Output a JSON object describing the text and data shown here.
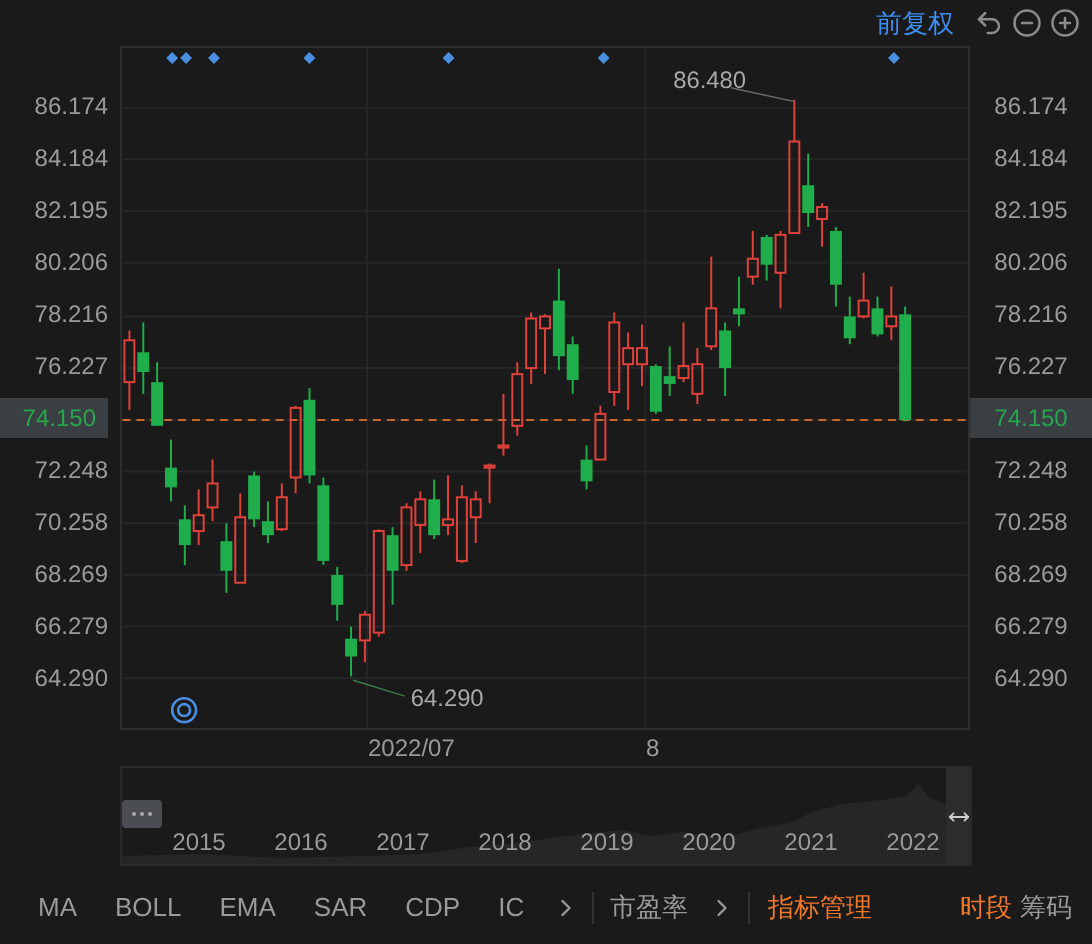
{
  "header": {
    "adjust_mode": "前复权"
  },
  "chart": {
    "high_label": "86.480",
    "low_label": "64.290",
    "x_labels": [
      "2022/07",
      "8"
    ],
    "chart_data": {
      "type": "candlestick",
      "ylim": [
        62.3,
        88.47
      ],
      "grid": true,
      "ref_lines": [
        {
          "axis": "y",
          "value": 74.15,
          "label": "74.150"
        }
      ],
      "yticks": [
        {
          "value": 86.174,
          "label": "86.174"
        },
        {
          "value": 84.184,
          "label": "84.184"
        },
        {
          "value": 82.195,
          "label": "82.195"
        },
        {
          "value": 80.206,
          "label": "80.206"
        },
        {
          "value": 78.216,
          "label": "78.216"
        },
        {
          "value": 76.227,
          "label": "76.227"
        },
        {
          "value": 72.248,
          "label": "72.248"
        },
        {
          "value": 70.258,
          "label": "70.258"
        },
        {
          "value": 68.269,
          "label": "68.269"
        },
        {
          "value": 66.279,
          "label": "66.279"
        },
        {
          "value": 64.29,
          "label": "64.290"
        }
      ],
      "categories": [
        null,
        null,
        null,
        null,
        null,
        null,
        null,
        null,
        null,
        null,
        null,
        null,
        null,
        null,
        null,
        null,
        null,
        null,
        null,
        null,
        null,
        null,
        null,
        null,
        null,
        null,
        null,
        null,
        null,
        null,
        null,
        null,
        null,
        null,
        null,
        null,
        null,
        null,
        null,
        null,
        null,
        null,
        null,
        null,
        null,
        null,
        null,
        null,
        null,
        null,
        null,
        null,
        null,
        null,
        null,
        null,
        null,
        null,
        null,
        null,
        null
      ],
      "ohlc": [
        [
          75.61,
          77.6,
          74.54,
          77.22
        ],
        [
          76.76,
          77.91,
          75.16,
          76.0
        ],
        [
          75.61,
          76.38,
          73.93,
          73.93
        ],
        [
          72.32,
          73.4,
          71.02,
          71.56
        ],
        [
          70.33,
          70.87,
          68.57,
          69.34
        ],
        [
          69.88,
          71.48,
          69.34,
          70.49
        ],
        [
          70.79,
          72.63,
          70.26,
          71.71
        ],
        [
          69.49,
          70.18,
          67.5,
          68.35
        ],
        [
          67.89,
          71.33,
          67.89,
          70.41
        ],
        [
          72.02,
          72.17,
          70.03,
          70.33
        ],
        [
          70.26,
          71.02,
          69.42,
          69.72
        ],
        [
          69.95,
          71.71,
          69.88,
          71.18
        ],
        [
          71.94,
          74.7,
          71.33,
          74.62
        ],
        [
          74.93,
          75.38,
          71.71,
          72.02
        ],
        [
          71.64,
          71.94,
          68.57,
          68.73
        ],
        [
          68.19,
          68.5,
          66.43,
          67.04
        ],
        [
          65.74,
          66.2,
          64.29,
          65.05
        ],
        [
          65.67,
          66.81,
          64.83,
          66.66
        ],
        [
          65.97,
          69.95,
          65.82,
          69.88
        ],
        [
          69.72,
          70.03,
          67.04,
          68.35
        ],
        [
          68.57,
          70.95,
          68.35,
          70.79
        ],
        [
          70.11,
          71.41,
          69.03,
          71.1
        ],
        [
          71.1,
          71.86,
          69.57,
          69.72
        ],
        [
          70.11,
          72.02,
          69.72,
          70.33
        ],
        [
          68.73,
          71.64,
          68.65,
          71.18
        ],
        [
          70.41,
          71.41,
          69.42,
          71.1
        ],
        [
          72.32,
          72.48,
          70.95,
          72.4
        ],
        [
          73.09,
          75.16,
          72.78,
          73.17
        ],
        [
          73.93,
          76.38,
          73.55,
          75.92
        ],
        [
          76.15,
          78.29,
          75.54,
          78.06
        ],
        [
          77.68,
          78.22,
          75.92,
          78.14
        ],
        [
          78.75,
          79.98,
          76.07,
          76.61
        ],
        [
          77.07,
          77.37,
          75.16,
          75.69
        ],
        [
          72.63,
          73.17,
          71.48,
          71.79
        ],
        [
          72.63,
          74.7,
          72.63,
          74.39
        ],
        [
          75.23,
          78.29,
          74.7,
          77.91
        ],
        [
          76.3,
          77.53,
          74.54,
          76.92
        ],
        [
          76.3,
          77.83,
          75.46,
          76.92
        ],
        [
          76.23,
          76.3,
          74.39,
          74.47
        ],
        [
          75.84,
          76.99,
          75.08,
          75.54
        ],
        [
          75.77,
          77.91,
          75.61,
          76.23
        ],
        [
          75.16,
          76.92,
          74.77,
          76.3
        ],
        [
          76.99,
          80.44,
          76.84,
          78.45
        ],
        [
          77.6,
          77.91,
          75.08,
          76.15
        ],
        [
          78.45,
          79.67,
          77.76,
          78.22
        ],
        [
          79.67,
          81.43,
          79.36,
          80.36
        ],
        [
          81.2,
          81.28,
          79.52,
          80.13
        ],
        [
          79.82,
          81.43,
          78.45,
          81.28
        ],
        [
          81.35,
          86.48,
          81.35,
          84.87
        ],
        [
          83.19,
          84.41,
          81.58,
          82.12
        ],
        [
          81.89,
          82.5,
          80.82,
          82.35
        ],
        [
          81.43,
          81.58,
          78.52,
          79.36
        ],
        [
          78.14,
          78.9,
          77.07,
          77.3
        ],
        [
          78.14,
          79.82,
          78.06,
          78.75
        ],
        [
          78.45,
          78.9,
          77.37,
          77.45
        ],
        [
          77.76,
          79.29,
          77.22,
          78.14
        ],
        [
          78.22,
          78.52,
          74.1,
          74.15
        ],
        null,
        null,
        null,
        null
      ]
    }
  },
  "right_axis": {
    "ticks": [
      "86.174",
      "84.184",
      "82.195",
      "80.206",
      "78.216",
      "76.227",
      "72.248",
      "70.258",
      "68.269",
      "66.279",
      "64.290"
    ],
    "current_price": "74.150"
  },
  "navigator": {
    "years": [
      "2015",
      "2016",
      "2017",
      "2018",
      "2019",
      "2020",
      "2021",
      "2022"
    ]
  },
  "indicators": [
    {
      "label": "MA"
    },
    {
      "label": "BOLL"
    },
    {
      "label": "EMA"
    },
    {
      "label": "SAR"
    },
    {
      "label": "CDP"
    },
    {
      "label": "IC"
    }
  ],
  "valuation": "市盈率",
  "manage": "指标管理",
  "side_tabs": [
    {
      "label": "时段",
      "selected": true
    },
    {
      "label": "筹码",
      "selected": false
    }
  ]
}
